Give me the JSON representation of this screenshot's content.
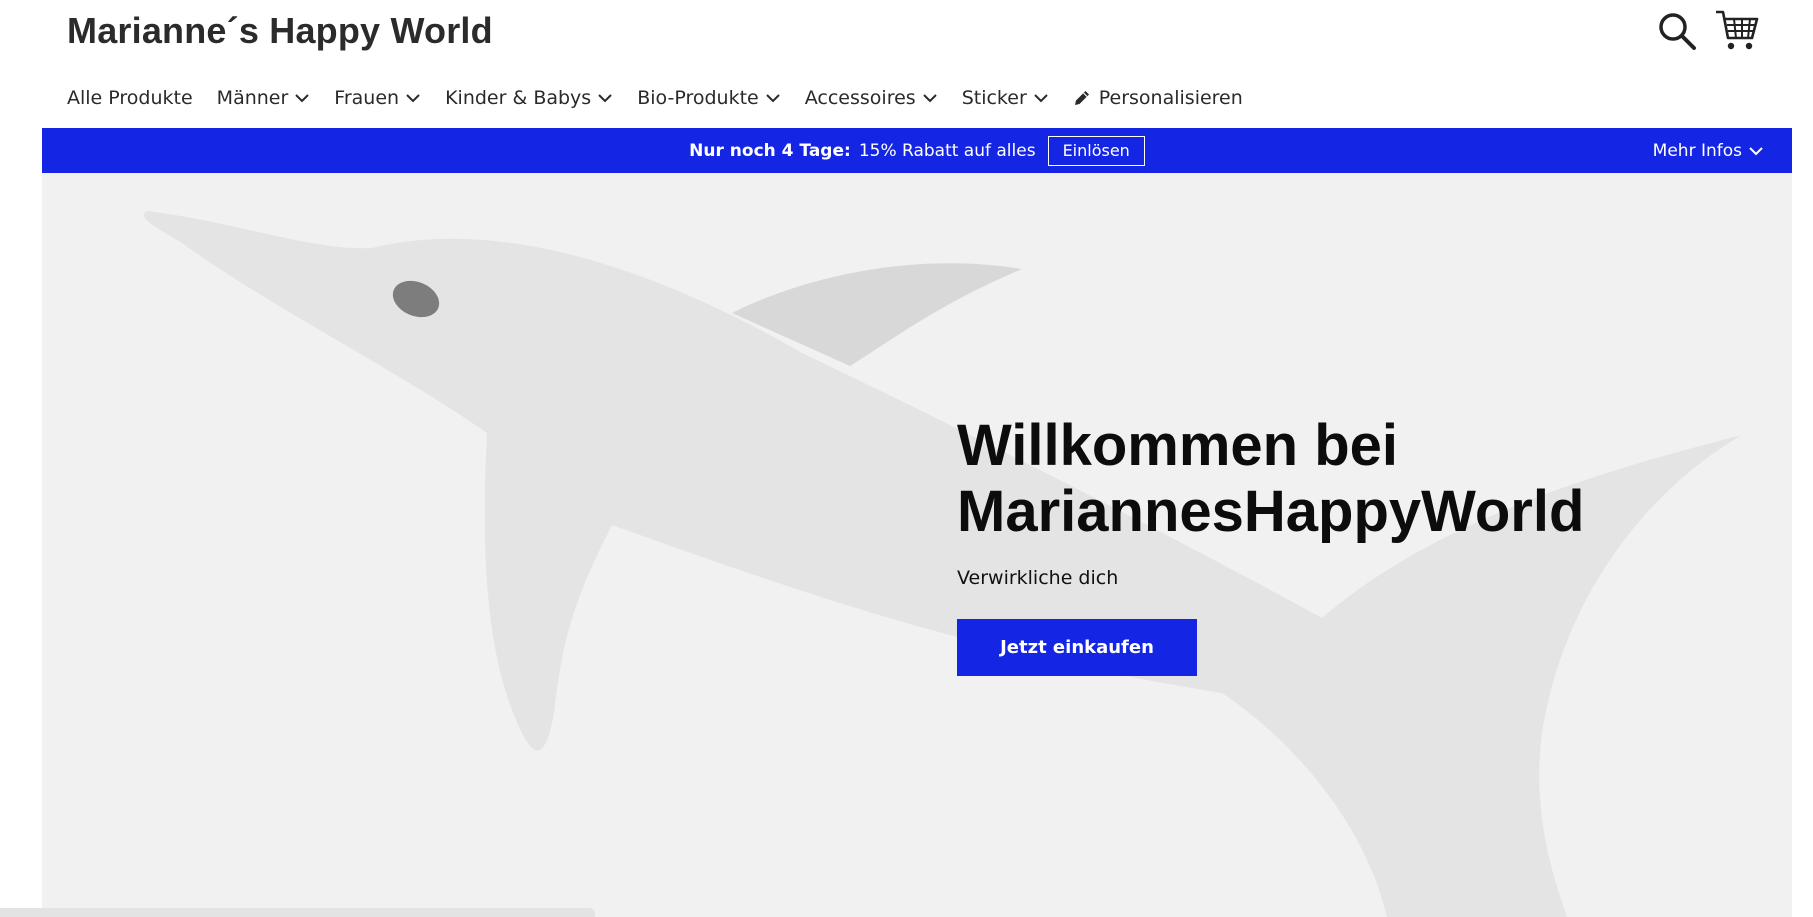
{
  "header": {
    "logo": "Marianne´s Happy World",
    "search_icon": "search-icon",
    "cart_icon": "cart-icon"
  },
  "nav": {
    "items": [
      {
        "label": "Alle Produkte",
        "dropdown": false
      },
      {
        "label": "Männer",
        "dropdown": true
      },
      {
        "label": "Frauen",
        "dropdown": true
      },
      {
        "label": "Kinder & Babys",
        "dropdown": true
      },
      {
        "label": "Bio-Produkte",
        "dropdown": true
      },
      {
        "label": "Accessoires",
        "dropdown": true
      },
      {
        "label": "Sticker",
        "dropdown": true
      },
      {
        "label": "Personalisieren",
        "dropdown": false,
        "icon": "pencil-icon"
      }
    ]
  },
  "promo": {
    "strong": "Nur noch 4 Tage:",
    "text": "15% Rabatt auf alles",
    "button": "Einlösen",
    "more": "Mehr Infos",
    "background": "#1426e3"
  },
  "hero": {
    "title_line1": "Willkommen bei",
    "title_line2": "MariannesHappyWorld",
    "subtitle": "Verwirkliche dich",
    "cta": "Jetzt einkaufen",
    "background": "#f1f1f1",
    "illustration": "dolphin-illustration"
  },
  "colors": {
    "accent": "#1426e3",
    "text": "#2a2a2a"
  }
}
